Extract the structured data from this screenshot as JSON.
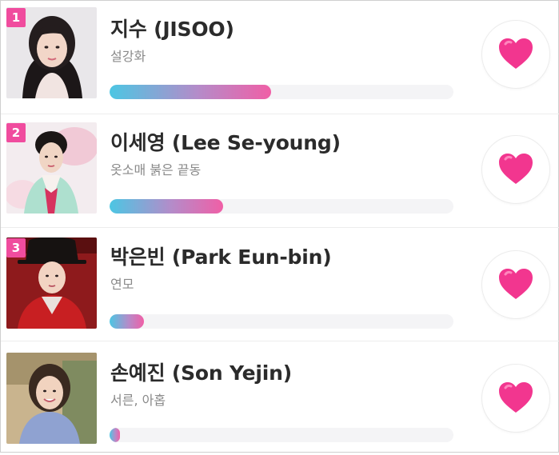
{
  "ranking": {
    "items": [
      {
        "rank": "1",
        "name": "지수 (JISOO)",
        "work": "설강화",
        "vote_share": 0.47,
        "photo": "portrait-jisoo"
      },
      {
        "rank": "2",
        "name": "이세영 (Lee Se-young)",
        "work": "옷소매 붉은 끝동",
        "vote_share": 0.33,
        "photo": "portrait-lee-se-young"
      },
      {
        "rank": "3",
        "name": "박은빈 (Park Eun-bin)",
        "work": "연모",
        "vote_share": 0.1,
        "photo": "portrait-park-eun-bin"
      },
      {
        "name": "손예진 (Son Yejin)",
        "work": "서른, 아홉",
        "vote_share": 0.03,
        "photo": "portrait-son-yejin"
      }
    ]
  },
  "icons": {
    "vote": "heart-icon"
  },
  "colors": {
    "rank_badge": "#f04c9e",
    "bar_start": "#4cc6e3",
    "bar_end": "#f05fa6",
    "heart": "#f2368f"
  }
}
